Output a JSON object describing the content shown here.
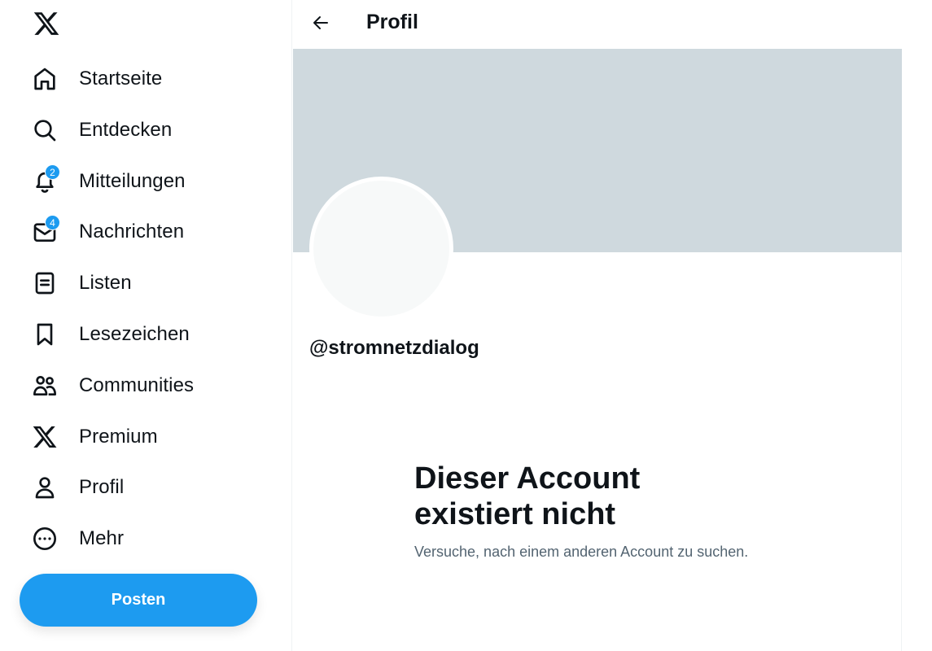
{
  "sidebar": {
    "items": [
      {
        "key": "home",
        "label": "Startseite",
        "icon": "home-icon"
      },
      {
        "key": "explore",
        "label": "Entdecken",
        "icon": "search-icon"
      },
      {
        "key": "notifications",
        "label": "Mitteilungen",
        "icon": "bell-icon",
        "badge": "2"
      },
      {
        "key": "messages",
        "label": "Nachrichten",
        "icon": "mail-icon",
        "badge": "4"
      },
      {
        "key": "lists",
        "label": "Listen",
        "icon": "list-icon"
      },
      {
        "key": "bookmarks",
        "label": "Lesezeichen",
        "icon": "bookmark-icon"
      },
      {
        "key": "communities",
        "label": "Communities",
        "icon": "people-icon"
      },
      {
        "key": "premium",
        "label": "Premium",
        "icon": "x-logo-icon"
      },
      {
        "key": "profile",
        "label": "Profil",
        "icon": "person-icon"
      },
      {
        "key": "more",
        "label": "Mehr",
        "icon": "more-circle-icon"
      }
    ],
    "post_label": "Posten"
  },
  "header": {
    "title": "Profil"
  },
  "profile": {
    "handle": "@stromnetzdialog"
  },
  "empty_state": {
    "title_line1": "Dieser Account",
    "title_line2": "existiert nicht",
    "subtitle": "Versuche, nach einem anderen Account zu suchen."
  },
  "colors": {
    "accent": "#1d9bf0",
    "text": "#0f1419",
    "secondary_text": "#536471",
    "banner": "#cfd9de",
    "avatar": "#f7f9f9"
  }
}
